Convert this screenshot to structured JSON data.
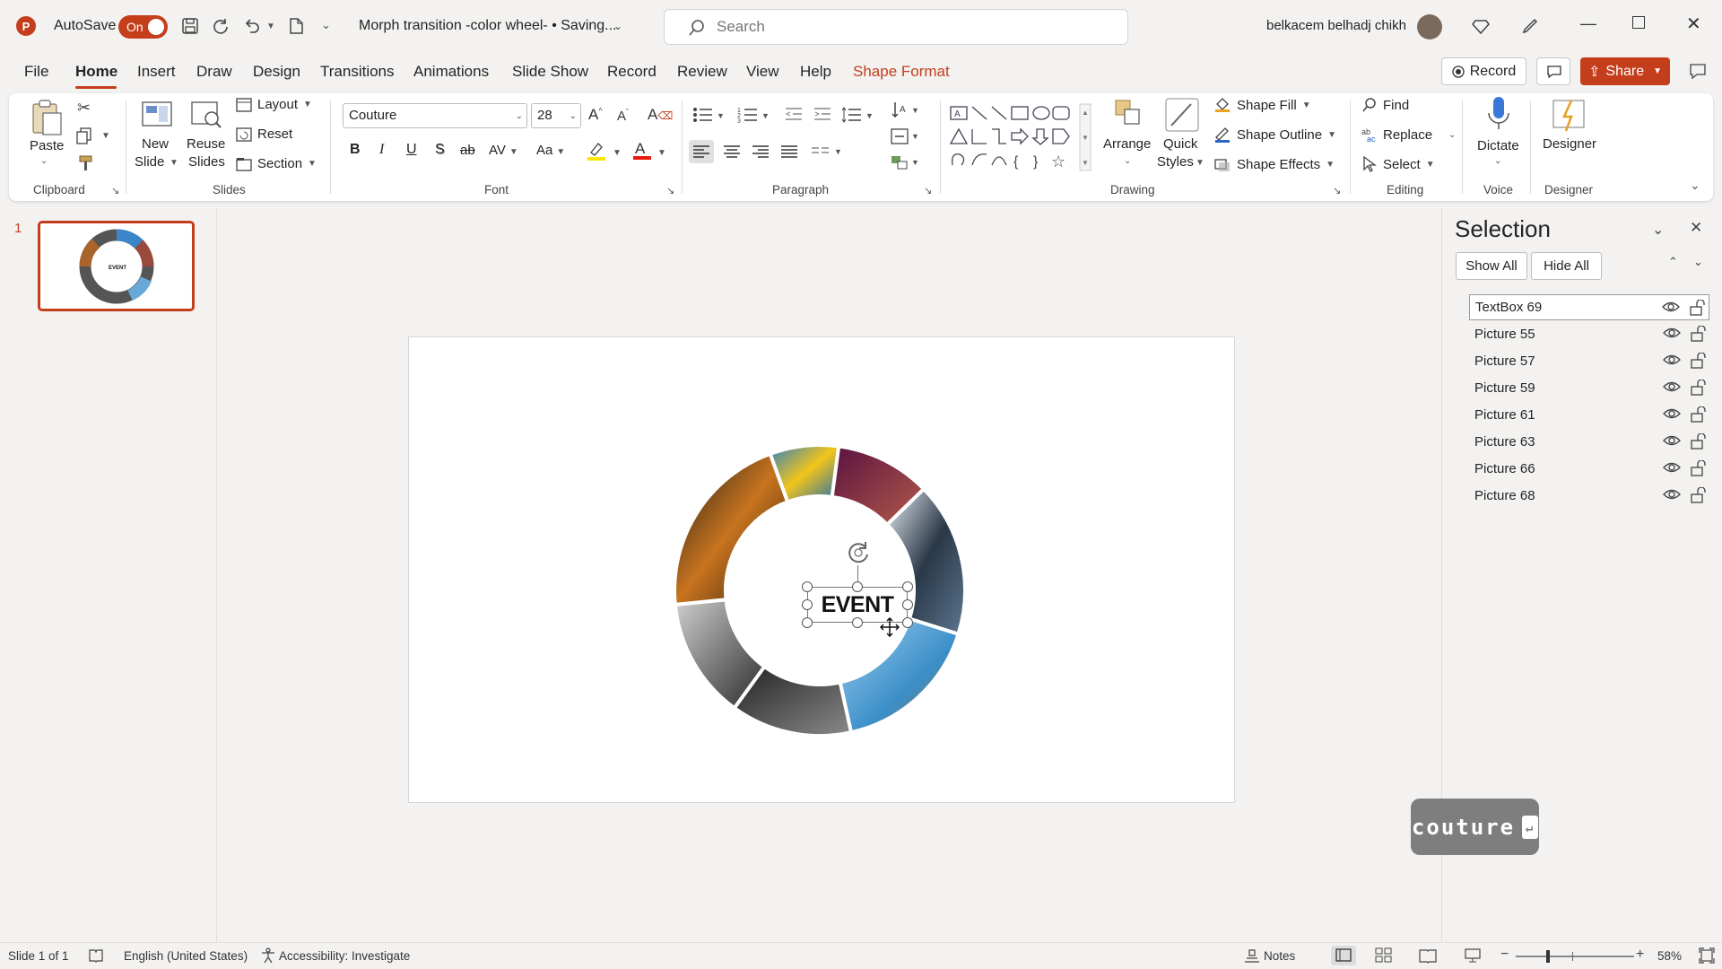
{
  "app": {
    "logo": "P",
    "autosave_label": "AutoSave",
    "autosave_state": "On",
    "doc_title": "Morph transition -color wheel- • Saving...",
    "search_placeholder": "Search",
    "user_name": "belkacem belhadj chikh"
  },
  "tabs": [
    "File",
    "Home",
    "Insert",
    "Draw",
    "Design",
    "Transitions",
    "Animations",
    "Slide Show",
    "Record",
    "Review",
    "View",
    "Help",
    "Shape Format"
  ],
  "tab_active": "Home",
  "header_buttons": {
    "record": "Record",
    "share": "Share"
  },
  "ribbon": {
    "clipboard": {
      "label": "Clipboard",
      "paste": "Paste"
    },
    "slides": {
      "label": "Slides",
      "new_slide_1": "New",
      "new_slide_2": "Slide",
      "reuse_1": "Reuse",
      "reuse_2": "Slides",
      "layout": "Layout",
      "reset": "Reset",
      "section": "Section"
    },
    "font": {
      "label": "Font",
      "font_name": "Couture",
      "font_size": "28",
      "bold": "B",
      "italic": "I",
      "underline": "U",
      "shadow": "S",
      "strike": "ab",
      "spacing": "AV",
      "case": "Aa"
    },
    "paragraph": {
      "label": "Paragraph"
    },
    "drawing": {
      "label": "Drawing",
      "arrange": "Arrange",
      "quick_styles_1": "Quick",
      "quick_styles_2": "Styles",
      "shape_fill": "Shape Fill",
      "shape_outline": "Shape Outline",
      "shape_effects": "Shape Effects"
    },
    "editing": {
      "label": "Editing",
      "find": "Find",
      "replace": "Replace",
      "select": "Select"
    },
    "voice": {
      "label": "Voice",
      "dictate": "Dictate"
    },
    "designer": {
      "label": "Designer",
      "designer": "Designer"
    }
  },
  "thumbnails": {
    "slide_number": "1"
  },
  "slide": {
    "textbox_text": "EVENT"
  },
  "selection_pane": {
    "title": "Selection",
    "show_all": "Show All",
    "hide_all": "Hide All",
    "items": [
      "TextBox 69",
      "Picture 55",
      "Picture 57",
      "Picture 59",
      "Picture 61",
      "Picture 63",
      "Picture 66",
      "Picture 68"
    ],
    "selected_index": 0
  },
  "keystroke_overlay": "couture",
  "status": {
    "slide_info": "Slide 1 of 1",
    "language": "English (United States)",
    "accessibility": "Accessibility: Investigate",
    "notes": "Notes",
    "zoom": "58%"
  },
  "colors": {
    "accent": "#c43e1c",
    "ribbon_bg": "#ffffff",
    "chrome_bg": "#f3f2f1"
  }
}
